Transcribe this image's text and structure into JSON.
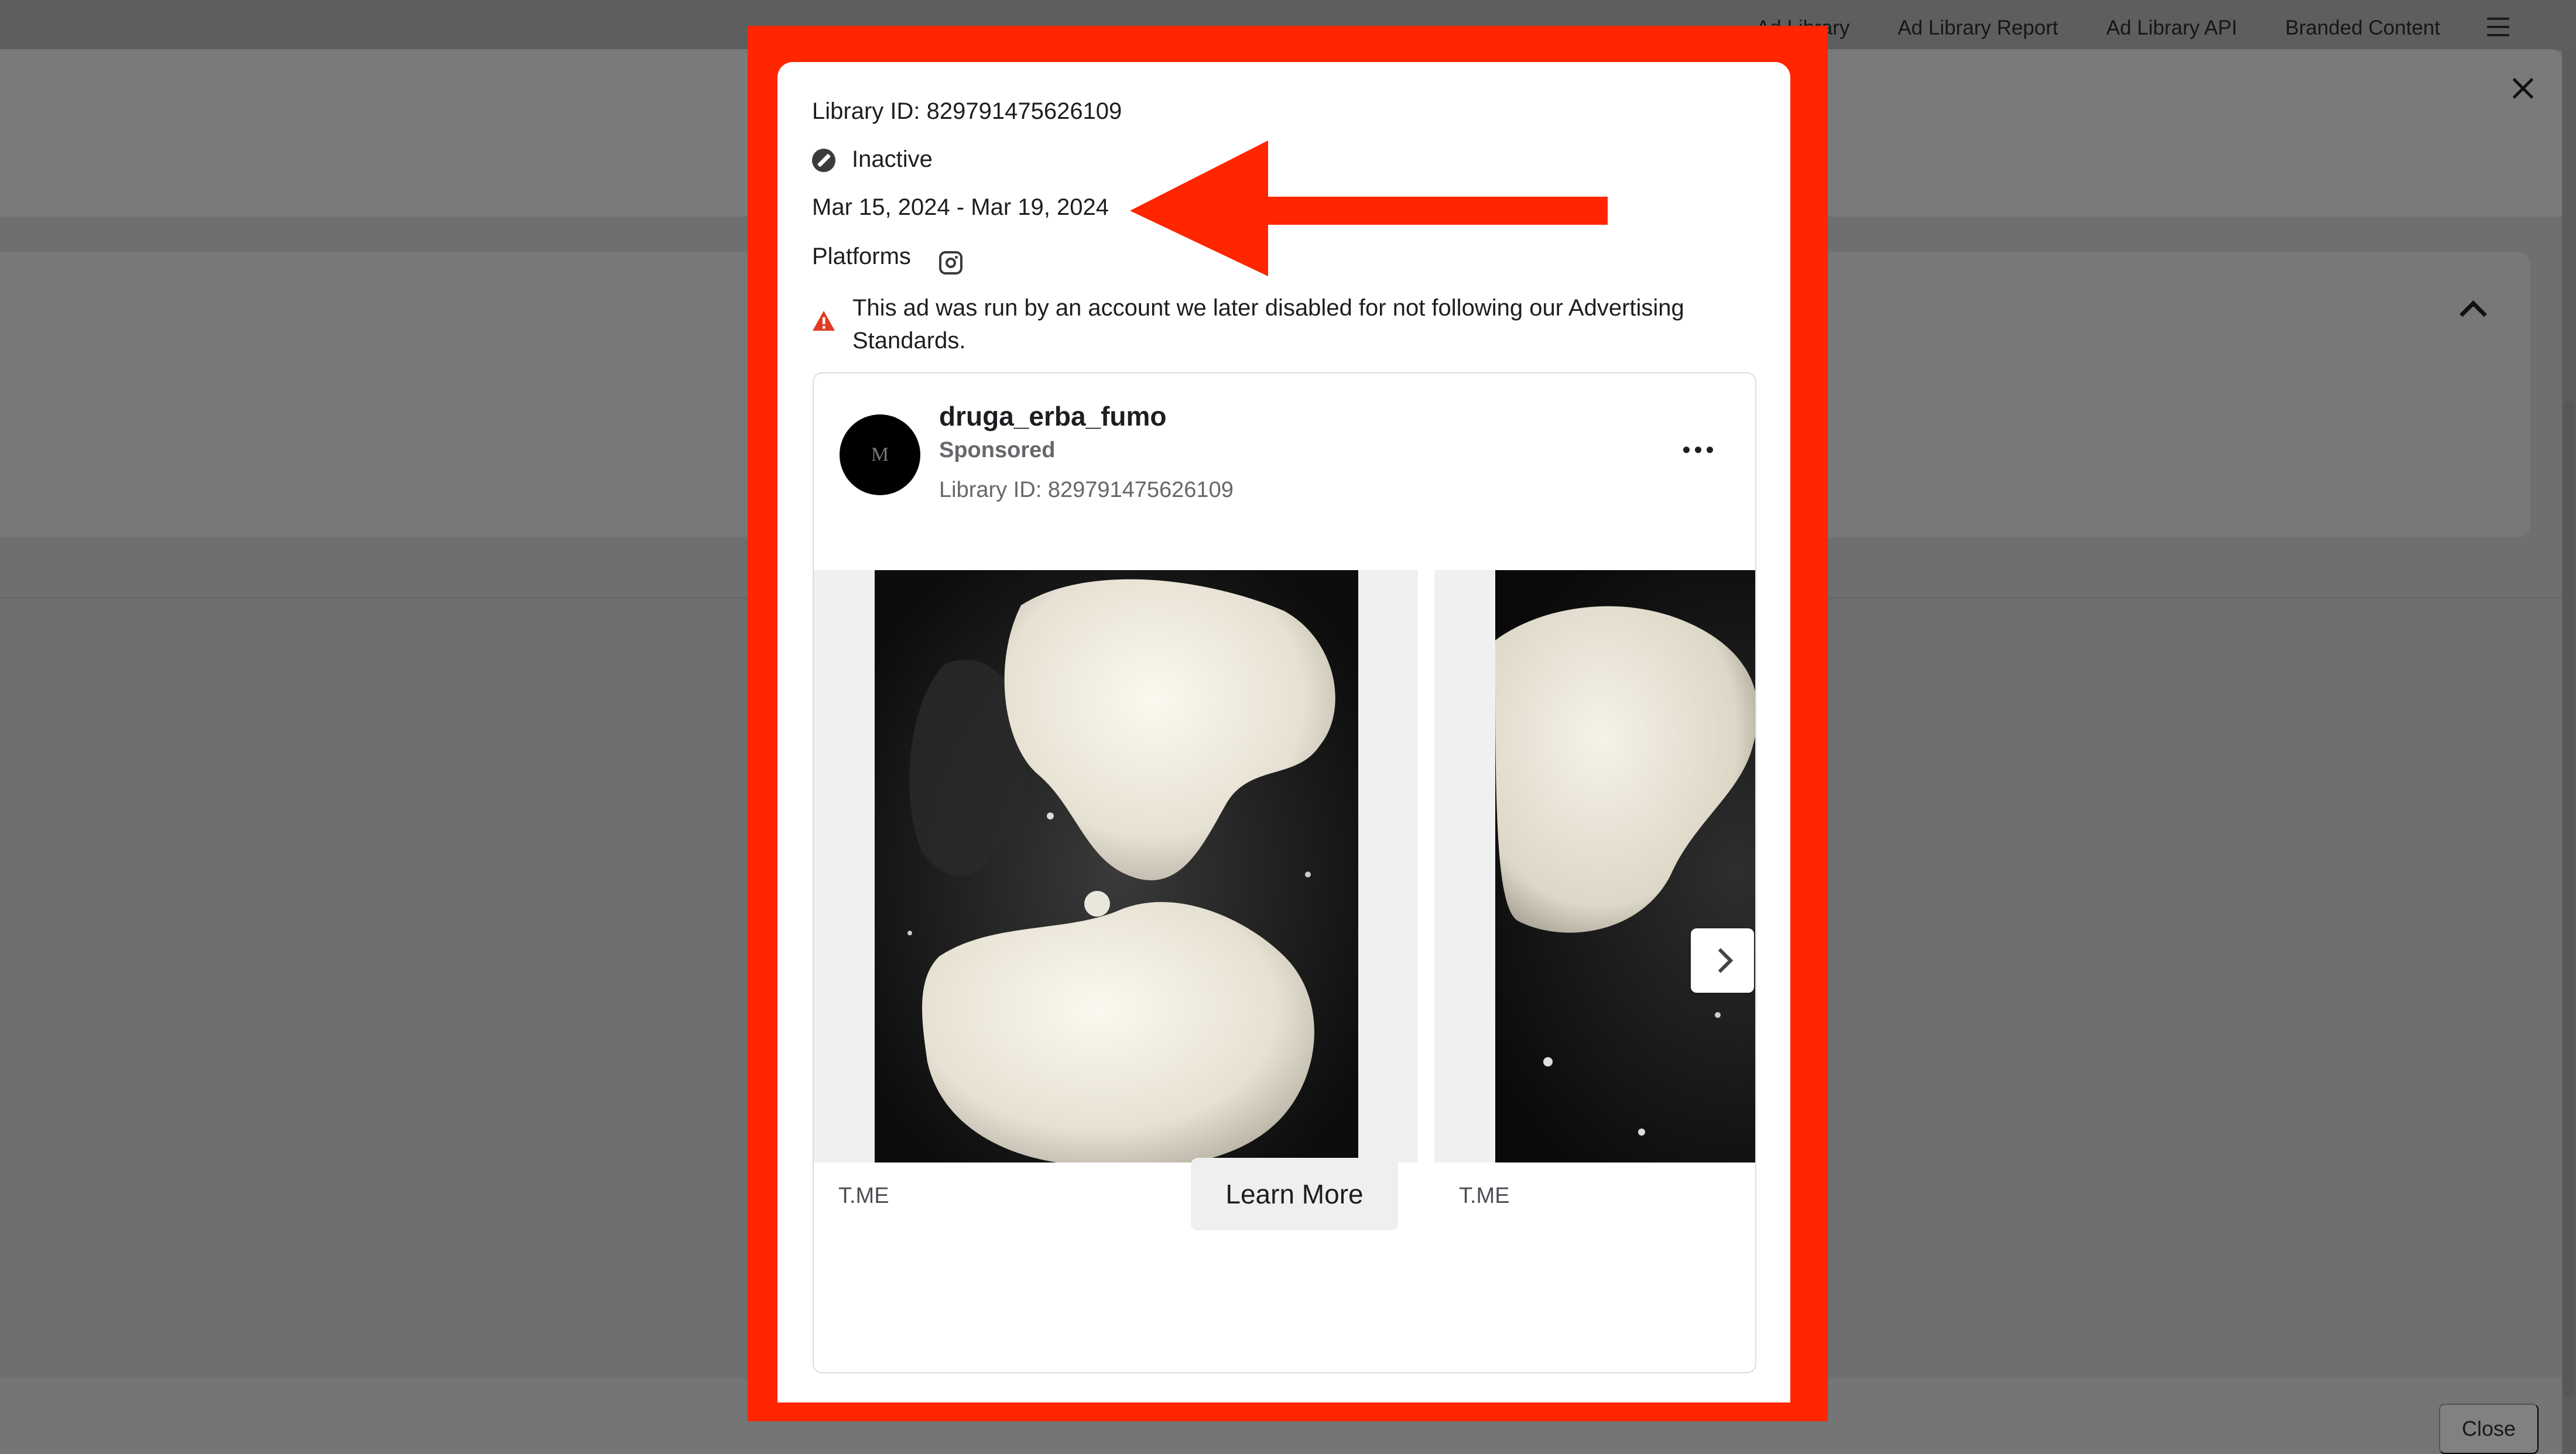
{
  "topnav": {
    "items": [
      "Ad Library",
      "Ad Library Report",
      "Ad Library API",
      "Branded Content"
    ],
    "menu_icon": "hamburger-menu-icon"
  },
  "modal": {
    "library_id": "Library ID: 829791475626109",
    "status": "Inactive",
    "status_icon": "inactive-icon",
    "date_range": "Mar 15, 2024 - Mar 19, 2024",
    "platforms_label": "Platforms",
    "platform_icon": "instagram-icon",
    "warning_icon": "warning-icon",
    "warning_text": "This ad was run by an account we later disabled for not following our Advertising Standards."
  },
  "ad": {
    "avatar_letter": "M",
    "page_name": "druga_erba_fumo",
    "sponsored_label": "Sponsored",
    "library_id": "Library ID: 829791475626109",
    "more_icon": "more-options-icon",
    "slides": [
      {
        "domain": "T.ME",
        "cta": "Learn More"
      },
      {
        "domain": "T.ME"
      }
    ],
    "next_icon": "chevron-right-icon"
  },
  "footer": {
    "close_label": "Close"
  },
  "colors": {
    "highlight": "#ff2600",
    "overlay": "#6f6f6f"
  }
}
